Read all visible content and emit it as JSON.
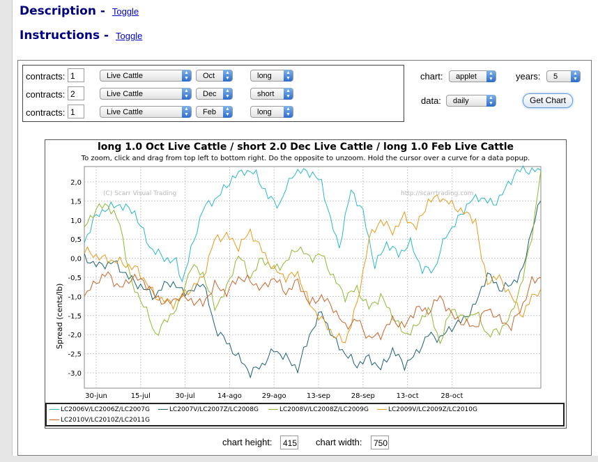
{
  "sections": {
    "description": {
      "title": "Description -",
      "toggle": "Toggle"
    },
    "instructions": {
      "title": "Instructions -",
      "toggle": "Toggle"
    }
  },
  "contracts_label": "contracts:",
  "contracts": [
    {
      "qty": "1",
      "commodity": "Live Cattle",
      "month": "Oct",
      "position": "long"
    },
    {
      "qty": "2",
      "commodity": "Live Cattle",
      "month": "Dec",
      "position": "short"
    },
    {
      "qty": "1",
      "commodity": "Live Cattle",
      "month": "Feb",
      "position": "long"
    }
  ],
  "options": {
    "chart_label": "chart:",
    "chart_value": "applet",
    "years_label": "years:",
    "years_value": "5",
    "data_label": "data:",
    "data_value": "daily",
    "get_chart": "Get Chart"
  },
  "chart": {
    "title": "long 1.0 Oct Live Cattle / short 2.0 Dec Live Cattle / long 1.0 Feb Live Cattle",
    "subtitle": "To zoom, click and drag from top left to bottom right. Do the opposite to unzoom. Hold the cursor over a curve for a data popup.",
    "ylabel": "Spread (cents/lb)",
    "watermark_left": "(C) Scarr Visual Trading",
    "watermark_right": "http://scarrtrading.com",
    "yticks": [
      "2,0",
      "1,5",
      "1,0",
      "0,5",
      "0,0",
      "-0,5",
      "-1,0",
      "-1,5",
      "-2,0",
      "-2,5",
      "-3,0"
    ],
    "xticks": [
      "30-jun",
      "15-jul",
      "30-jul",
      "14-ago",
      "29-ago",
      "13-sep",
      "28-sep",
      "13-oct",
      "28-oct"
    ]
  },
  "colors": {
    "series1": "#28b8c8",
    "series2": "#1a6070",
    "series3": "#90b830",
    "series4": "#e89a18",
    "series5": "#c8642a",
    "bar": "#e6e6e6",
    "link": "#0000cc",
    "heading": "#000080"
  },
  "chart_data": {
    "type": "line",
    "title": "long 1.0 Oct Live Cattle / short 2.0 Dec Live Cattle / long 1.0 Feb Live Cattle",
    "xlabel": "",
    "ylabel": "Spread (cents/lb)",
    "ylim": [
      -3.2,
      2.25
    ],
    "x_ticks": [
      "30-jun",
      "15-jul",
      "30-jul",
      "14-ago",
      "29-ago",
      "13-sep",
      "28-sep",
      "13-oct",
      "28-oct"
    ],
    "grid": true,
    "legend": "bottom",
    "series": [
      {
        "name": "LC2006V/LC2006Z/LC2007G",
        "color": "#28b8c8",
        "points": [
          [
            0,
            0.4
          ],
          [
            3,
            1.0
          ],
          [
            7,
            1.3
          ],
          [
            12,
            1.4
          ],
          [
            17,
            1.2
          ],
          [
            22,
            0.3
          ],
          [
            27,
            0.0
          ],
          [
            31,
            -0.1
          ],
          [
            33,
            -0.6
          ],
          [
            36,
            0.2
          ],
          [
            40,
            1.3
          ],
          [
            45,
            1.6
          ],
          [
            50,
            2.1
          ],
          [
            54,
            2.3
          ],
          [
            58,
            2.2
          ],
          [
            62,
            1.6
          ],
          [
            66,
            1.4
          ],
          [
            70,
            2.2
          ],
          [
            75,
            2.3
          ],
          [
            80,
            2.0
          ],
          [
            83,
            1.0
          ],
          [
            86,
            0.3
          ],
          [
            90,
            1.8
          ],
          [
            94,
            1.2
          ],
          [
            98,
            -0.2
          ],
          [
            102,
            0.4
          ],
          [
            106,
            0.1
          ],
          [
            110,
            0.4
          ],
          [
            114,
            -0.3
          ],
          [
            118,
            -0.3
          ],
          [
            122,
            0.6
          ],
          [
            126,
            1.0
          ],
          [
            130,
            1.5
          ],
          [
            134,
            1.6
          ],
          [
            138,
            1.4
          ],
          [
            142,
            1.8
          ],
          [
            146,
            2.3
          ],
          [
            150,
            2.3
          ],
          [
            154,
            2.3
          ]
        ]
      },
      {
        "name": "LC2007V/LC2007Z/LC2008G",
        "color": "#1a6070",
        "points": [
          [
            0,
            0.0
          ],
          [
            5,
            -0.2
          ],
          [
            10,
            -0.1
          ],
          [
            15,
            -0.5
          ],
          [
            20,
            -0.8
          ],
          [
            24,
            -1.0
          ],
          [
            28,
            -0.6
          ],
          [
            32,
            -0.8
          ],
          [
            36,
            -0.9
          ],
          [
            40,
            -0.6
          ],
          [
            44,
            -1.8
          ],
          [
            48,
            -2.2
          ],
          [
            52,
            -2.6
          ],
          [
            56,
            -3.0
          ],
          [
            60,
            -2.8
          ],
          [
            64,
            -2.4
          ],
          [
            68,
            -2.6
          ],
          [
            72,
            -2.9
          ],
          [
            76,
            -2.0
          ],
          [
            80,
            -1.4
          ],
          [
            84,
            -2.1
          ],
          [
            88,
            -2.5
          ],
          [
            92,
            -2.8
          ],
          [
            96,
            -2.6
          ],
          [
            100,
            -2.9
          ],
          [
            104,
            -2.4
          ],
          [
            108,
            -2.8
          ],
          [
            112,
            -2.5
          ],
          [
            116,
            -2.0
          ],
          [
            120,
            -2.1
          ],
          [
            124,
            -1.8
          ],
          [
            128,
            -1.6
          ],
          [
            132,
            -1.2
          ],
          [
            136,
            -0.4
          ],
          [
            140,
            -0.8
          ],
          [
            144,
            -0.7
          ],
          [
            148,
            -0.3
          ],
          [
            151,
            0.8
          ],
          [
            154,
            1.5
          ]
        ]
      },
      {
        "name": "LC2008V/LC2008Z/LC2009G",
        "color": "#90b830",
        "points": [
          [
            0,
            0.8
          ],
          [
            4,
            1.3
          ],
          [
            8,
            1.4
          ],
          [
            12,
            0.9
          ],
          [
            16,
            -0.7
          ],
          [
            20,
            -1.2
          ],
          [
            24,
            -2.0
          ],
          [
            28,
            -1.6
          ],
          [
            32,
            -1.2
          ],
          [
            36,
            -0.2
          ],
          [
            40,
            -0.4
          ],
          [
            44,
            -1.3
          ],
          [
            48,
            -0.8
          ],
          [
            52,
            0.1
          ],
          [
            56,
            -0.5
          ],
          [
            60,
            0.0
          ],
          [
            64,
            -0.3
          ],
          [
            68,
            -0.1
          ],
          [
            72,
            0.3
          ],
          [
            76,
            0.0
          ],
          [
            80,
            0.1
          ],
          [
            84,
            -0.5
          ],
          [
            88,
            -1.0
          ],
          [
            92,
            -0.8
          ],
          [
            96,
            -1.3
          ],
          [
            100,
            -1.0
          ],
          [
            104,
            -1.5
          ],
          [
            108,
            -2.0
          ],
          [
            112,
            -1.8
          ],
          [
            116,
            -1.3
          ],
          [
            120,
            -2.2
          ],
          [
            124,
            -1.3
          ],
          [
            128,
            -1.6
          ],
          [
            132,
            -1.4
          ],
          [
            136,
            -2.0
          ],
          [
            140,
            -1.9
          ],
          [
            144,
            -1.5
          ],
          [
            148,
            -0.5
          ],
          [
            151,
            0.6
          ],
          [
            154,
            2.3
          ]
        ]
      },
      {
        "name": "LC2009V/LC2009Z/LC2010G",
        "color": "#e89a18",
        "points": [
          [
            0,
            0.2
          ],
          [
            6,
            0.0
          ],
          [
            12,
            -0.1
          ],
          [
            18,
            -0.3
          ],
          [
            24,
            -1.0
          ],
          [
            30,
            -1.2
          ],
          [
            36,
            -0.8
          ],
          [
            40,
            -0.5
          ],
          [
            44,
            0.5
          ],
          [
            48,
            0.6
          ],
          [
            52,
            0.3
          ],
          [
            56,
            0.7
          ],
          [
            60,
            0.2
          ],
          [
            64,
            -0.3
          ],
          [
            68,
            -0.5
          ],
          [
            72,
            -0.4
          ],
          [
            76,
            -1.2
          ],
          [
            80,
            -1.6
          ],
          [
            84,
            -2.0
          ],
          [
            88,
            -2.2
          ],
          [
            92,
            -1.2
          ],
          [
            96,
            0.5
          ],
          [
            100,
            1.0
          ],
          [
            104,
            0.7
          ],
          [
            108,
            1.1
          ],
          [
            112,
            0.8
          ],
          [
            116,
            1.5
          ],
          [
            120,
            1.6
          ],
          [
            124,
            1.4
          ],
          [
            128,
            1.2
          ],
          [
            132,
            1.0
          ],
          [
            134,
            0.0
          ],
          [
            136,
            -0.6
          ],
          [
            140,
            -0.5
          ],
          [
            144,
            -1.0
          ],
          [
            148,
            -1.5
          ],
          [
            151,
            -1.0
          ],
          [
            154,
            -0.8
          ]
        ]
      },
      {
        "name": "LC2010V/LC2010Z/LC2011G",
        "color": "#c8642a",
        "points": [
          [
            0,
            -1.0
          ],
          [
            4,
            -0.6
          ],
          [
            8,
            -0.4
          ],
          [
            12,
            -0.8
          ],
          [
            16,
            -0.5
          ],
          [
            20,
            -0.6
          ],
          [
            24,
            -1.0
          ],
          [
            28,
            -1.2
          ],
          [
            32,
            -1.0
          ],
          [
            36,
            -1.1
          ],
          [
            40,
            -1.2
          ],
          [
            44,
            -0.7
          ],
          [
            48,
            -0.9
          ],
          [
            52,
            -0.5
          ],
          [
            56,
            -0.6
          ],
          [
            60,
            -0.8
          ],
          [
            64,
            -0.5
          ],
          [
            68,
            -0.9
          ],
          [
            72,
            -0.6
          ],
          [
            76,
            -1.2
          ],
          [
            80,
            -1.0
          ],
          [
            84,
            -1.3
          ],
          [
            88,
            -1.8
          ],
          [
            92,
            -1.6
          ],
          [
            96,
            -2.1
          ],
          [
            100,
            -2.0
          ],
          [
            104,
            -1.6
          ],
          [
            108,
            -1.8
          ],
          [
            112,
            -1.3
          ],
          [
            116,
            -1.4
          ],
          [
            120,
            -1.0
          ],
          [
            124,
            -1.5
          ],
          [
            128,
            -1.7
          ],
          [
            132,
            -1.8
          ],
          [
            136,
            -1.3
          ],
          [
            140,
            -1.6
          ],
          [
            144,
            -1.8
          ],
          [
            148,
            -1.2
          ],
          [
            151,
            -0.6
          ],
          [
            154,
            -0.5
          ]
        ]
      }
    ]
  },
  "dims": {
    "height_label": "chart height:",
    "height_value": "415",
    "width_label": "chart width:",
    "width_value": "750"
  }
}
